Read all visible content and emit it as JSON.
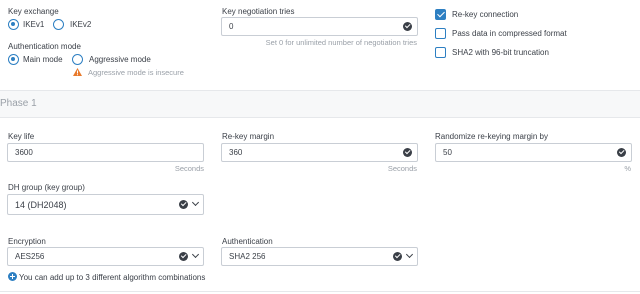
{
  "key_exchange": {
    "label": "Key exchange",
    "options": [
      {
        "label": "IKEv1",
        "selected": true
      },
      {
        "label": "IKEv2",
        "selected": false
      }
    ]
  },
  "key_negotiation": {
    "label": "Key negotiation tries",
    "value": "0",
    "hint": "Set 0 for unlimited number of negotiation tries"
  },
  "checkboxes": [
    {
      "label": "Re-key connection",
      "checked": true
    },
    {
      "label": "Pass data in compressed format",
      "checked": false
    },
    {
      "label": "SHA2 with 96-bit truncation",
      "checked": false
    }
  ],
  "auth_mode": {
    "label": "Authentication mode",
    "options": [
      {
        "label": "Main mode",
        "selected": true
      },
      {
        "label": "Aggressive mode",
        "selected": false
      }
    ],
    "warning": "Aggressive mode is insecure"
  },
  "phase1": {
    "title": "Phase 1",
    "key_life": {
      "label": "Key life",
      "value": "3600",
      "unit": "Seconds"
    },
    "rekey_margin": {
      "label": "Re-key margin",
      "value": "360",
      "unit": "Seconds"
    },
    "randomize": {
      "label": "Randomize re-keying margin by",
      "value": "50",
      "unit": "%"
    },
    "dh_group": {
      "label": "DH group (key group)",
      "value": "14 (DH2048)"
    },
    "encryption": {
      "label": "Encryption",
      "value": "AES256"
    },
    "authentication": {
      "label": "Authentication",
      "value": "SHA2 256"
    },
    "add_hint": "You can add up to 3 different algorithm combinations"
  },
  "colors": {
    "accent": "#2d7fc2",
    "warning": "#e8792b",
    "text": "#3a3f47",
    "muted": "#9aa0a8"
  }
}
